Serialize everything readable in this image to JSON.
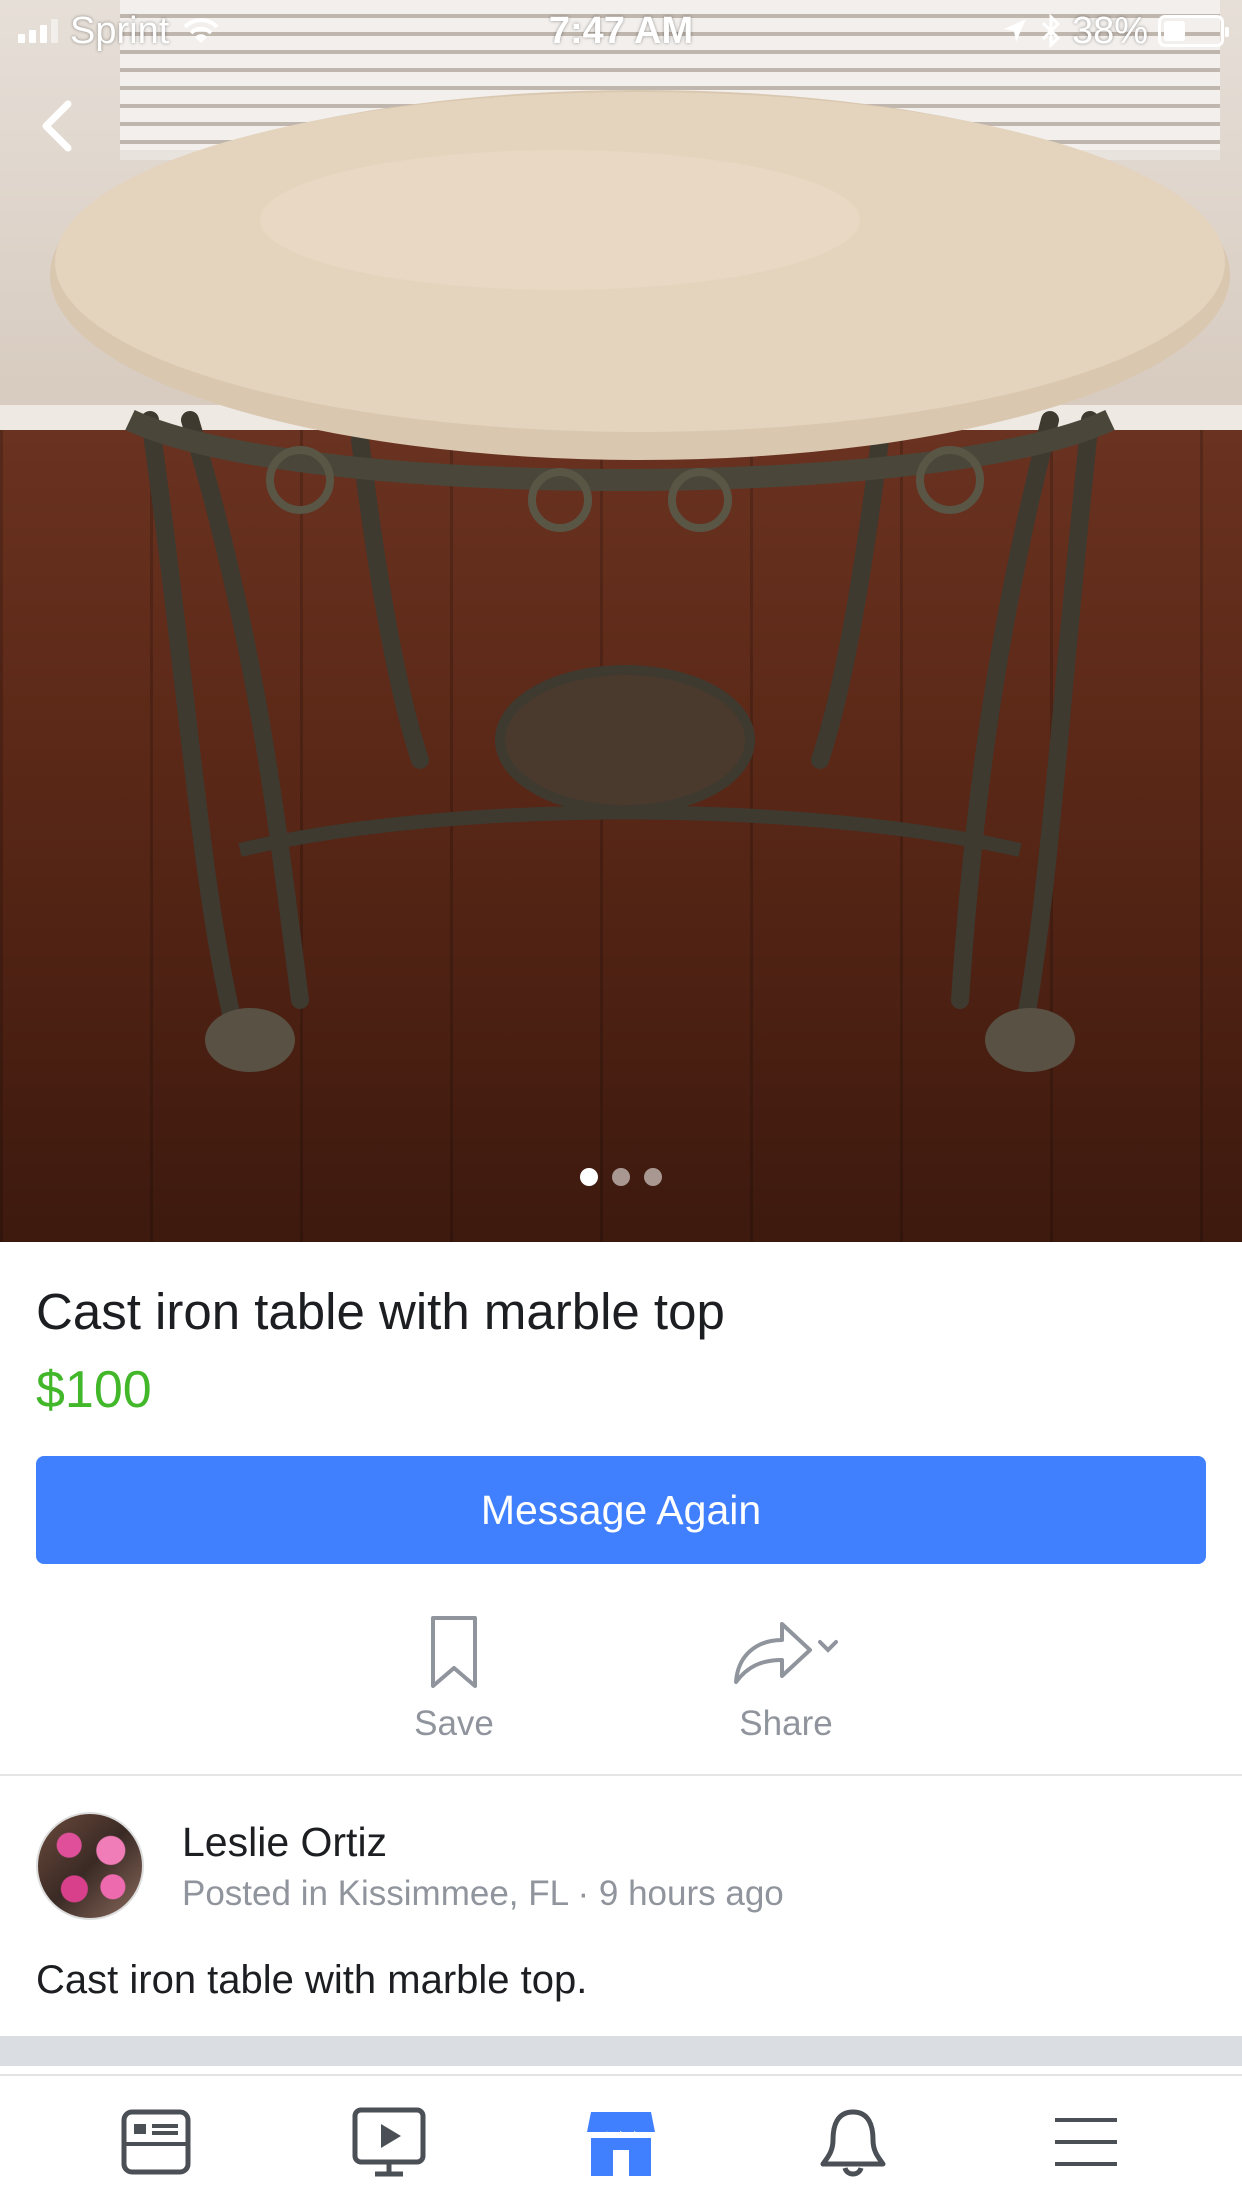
{
  "status_bar": {
    "carrier": "Sprint",
    "time": "7:47 AM",
    "battery": "38%",
    "battery_level": 0.38,
    "icons": [
      "signal-icon",
      "wifi-icon",
      "location-icon",
      "bluetooth-icon",
      "battery-icon"
    ]
  },
  "gallery": {
    "image_count": 3,
    "active_index": 0
  },
  "listing": {
    "title": "Cast iron table with marble top",
    "price": "$100",
    "cta_label": "Message Again",
    "description": "Cast iron table with marble top."
  },
  "actions": {
    "save_label": "Save",
    "share_label": "Share"
  },
  "seller": {
    "name": "Leslie Ortiz",
    "meta": "Posted in Kissimmee, FL · 9 hours ago"
  },
  "tab_bar": {
    "tabs": [
      {
        "icon": "news-feed-icon",
        "active": false
      },
      {
        "icon": "watch-video-icon",
        "active": false
      },
      {
        "icon": "marketplace-icon",
        "active": true
      },
      {
        "icon": "notifications-bell-icon",
        "active": false
      },
      {
        "icon": "menu-icon",
        "active": false
      }
    ]
  },
  "colors": {
    "accent_blue": "#4080ff",
    "price_green": "#42b72a",
    "muted_gray": "#90949c",
    "active_tab": "#4080ff",
    "inactive_tab": "#4b4f56"
  }
}
